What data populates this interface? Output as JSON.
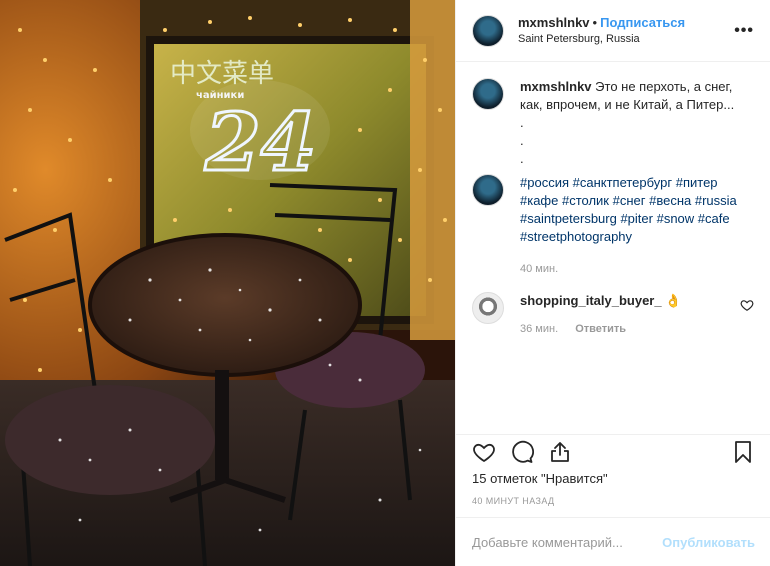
{
  "post": {
    "username": "mxmshlnkv",
    "follow_label": "Подписаться",
    "location": "Saint Petersburg, Russia",
    "more_icon": "more-horizontal-icon"
  },
  "photo": {
    "neon_sign": "中文菜单",
    "neon_sub": "чайники",
    "neon_number": "24"
  },
  "caption": {
    "username": "mxmshlnkv",
    "text": "Это не перхоть, а снег, как, впрочем, и не Китай, а Питер...",
    "dots": [
      ".",
      ".",
      "."
    ],
    "hashtags": "#россия #санктпетербург #питер #кафе #столик #снег #весна #russia #saintpetersburg #piter #snow #cafe #streetphotography",
    "time": "40 мин."
  },
  "comment": {
    "username": "shopping_italy_buyer_",
    "emoji": "👌",
    "time": "36 мин.",
    "reply_label": "Ответить"
  },
  "actions": {
    "likes": "15 отметок \"Нравится\"",
    "time_ago": "40 минут назад"
  },
  "add_comment": {
    "placeholder": "Добавьте комментарий...",
    "publish_label": "Опубликовать"
  },
  "colors": {
    "link": "#3897f0",
    "hashtag": "#003569",
    "muted": "#999999",
    "publish_disabled": "#b2dffc"
  }
}
